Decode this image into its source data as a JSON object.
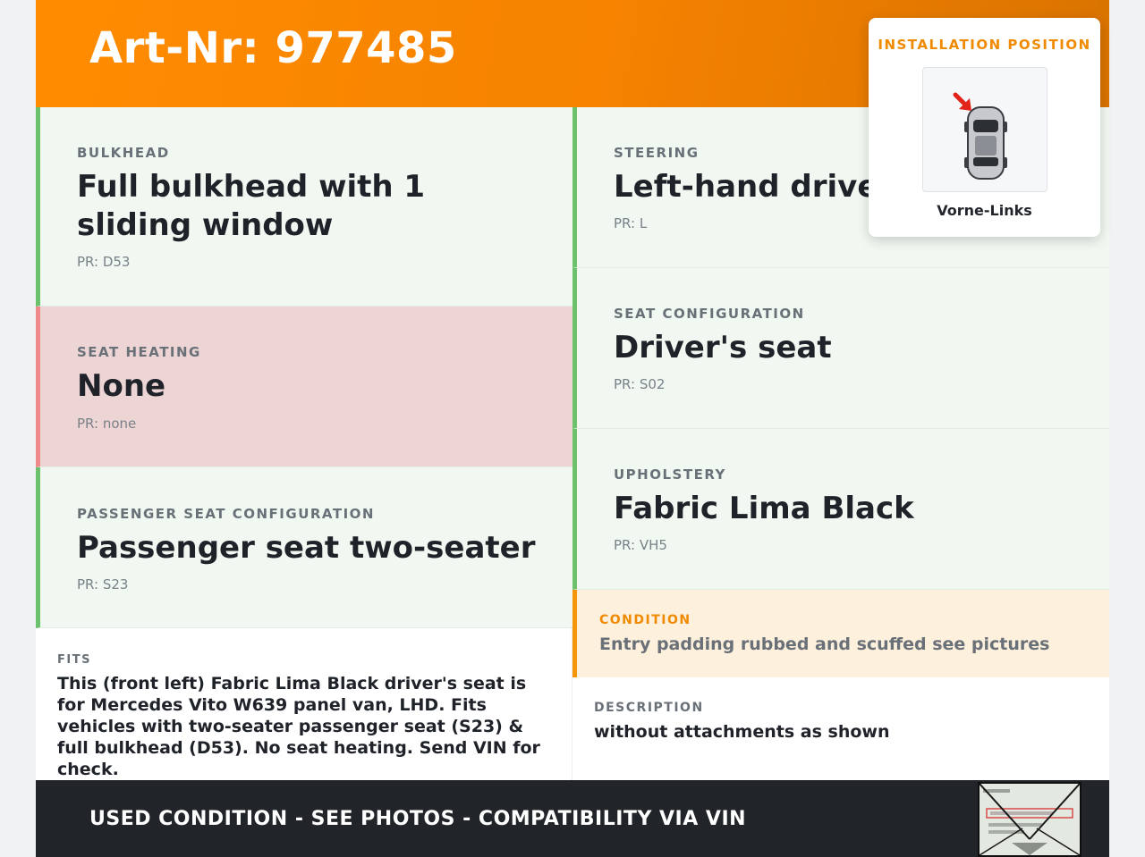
{
  "header": {
    "art_nr": "Art-Nr: 977485"
  },
  "specs_left": [
    {
      "label": "BULKHEAD",
      "value": "Full bulkhead with 1 sliding window",
      "pr": "PR: D53",
      "status": "ok"
    },
    {
      "label": "SEAT HEATING",
      "value": "None",
      "pr": "PR: none",
      "status": "bad"
    },
    {
      "label": "PASSENGER SEAT CONFIGURATION",
      "value": "Passenger seat two-seater",
      "pr": "PR: S23",
      "status": "ok"
    }
  ],
  "specs_right": [
    {
      "label": "STEERING",
      "value": "Left-hand drive",
      "pr": "PR: L",
      "status": "ok"
    },
    {
      "label": "SEAT CONFIGURATION",
      "value": "Driver's seat",
      "pr": "PR: S02",
      "status": "ok"
    },
    {
      "label": "UPHOLSTERY",
      "value": "Fabric Lima Black",
      "pr": "PR: VH5",
      "status": "ok"
    }
  ],
  "fits": {
    "label": "FITS",
    "text": "This (front left) Fabric Lima Black driver's seat is for Mercedes Vito W639 panel van, LHD. Fits vehicles with two-seater passenger seat (S23) & full bulkhead (D53). No seat heating. Send VIN for check."
  },
  "condition": {
    "label": "CONDITION",
    "text": "Entry padding rubbed and scuffed see pictures"
  },
  "description": {
    "label": "DESCRIPTION",
    "text": "without attachments as shown"
  },
  "footer": {
    "text": "USED CONDITION - SEE PHOTOS - COMPATIBILITY VIA VIN"
  },
  "installation": {
    "title": "INSTALLATION POSITION",
    "caption": "Vorne-Links",
    "icon": "car-top-view-icon"
  },
  "colors": {
    "accent": "#ff8c00",
    "ok_border": "#6cc26c",
    "ok_bg": "#f1f8f1",
    "bad_border": "#f08a8a",
    "bad_bg": "#edd5d5",
    "warn_border": "#f5960a",
    "warn_bg": "#fdf0dc",
    "footer_bg": "#212429"
  }
}
